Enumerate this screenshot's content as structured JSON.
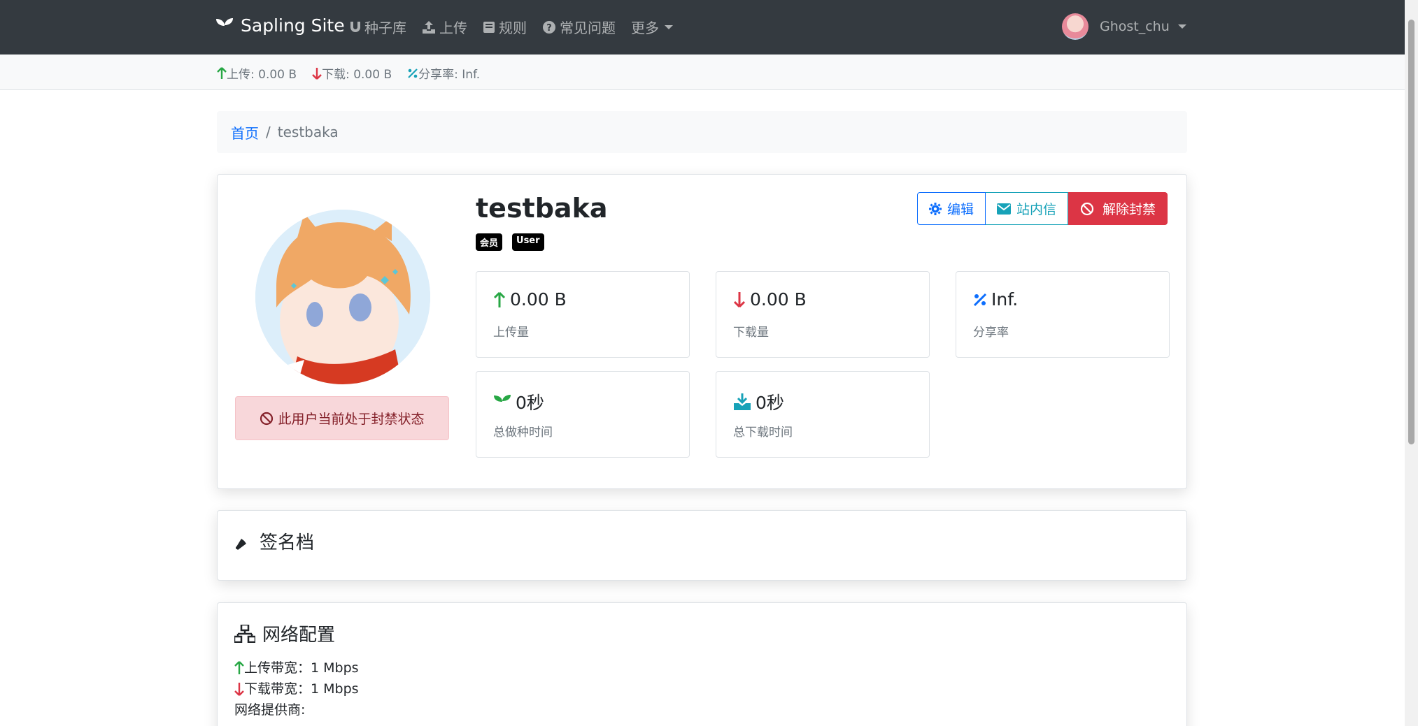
{
  "navbar": {
    "brand": "Sapling Site",
    "items": [
      {
        "label": "种子库",
        "icon": "magnet-icon"
      },
      {
        "label": "上传",
        "icon": "upload-icon"
      },
      {
        "label": "规则",
        "icon": "book-icon"
      },
      {
        "label": "常见问题",
        "icon": "question-circle-icon"
      },
      {
        "label": "更多",
        "icon": "caret-down-icon"
      }
    ],
    "user": "Ghost_chu"
  },
  "statsbar": {
    "upload": "上传: 0.00 B",
    "download": "下载: 0.00 B",
    "ratio": "分享率: Inf."
  },
  "breadcrumb": {
    "home": "首页",
    "current": "testbaka"
  },
  "profile": {
    "username": "testbaka",
    "badges": [
      "会员",
      "User"
    ],
    "ban_notice": "此用户当前处于封禁状态",
    "buttons": {
      "edit": "编辑",
      "message": "站内信",
      "unban": "解除封禁"
    },
    "stats": [
      {
        "value": "0.00 B",
        "label": "上传量",
        "icon": "arrow-up-icon"
      },
      {
        "value": "0.00 B",
        "label": "下载量",
        "icon": "arrow-down-icon"
      },
      {
        "value": "Inf.",
        "label": "分享率",
        "icon": "percent-icon"
      },
      {
        "value": "0秒",
        "label": "总做种时间",
        "icon": "seedling-icon"
      },
      {
        "value": "0秒",
        "label": "总下载时间",
        "icon": "download-icon"
      }
    ]
  },
  "signature": {
    "title": "签名档"
  },
  "network": {
    "title": "网络配置",
    "upload_bw": "上传带宽：1 Mbps",
    "download_bw": "下载带宽：1 Mbps",
    "isp": "网络提供商:"
  },
  "colors": {
    "navbar": "#343a40",
    "primary": "#0d6efd",
    "info": "#17a2b8",
    "danger": "#dc3545",
    "success": "#28a745"
  }
}
